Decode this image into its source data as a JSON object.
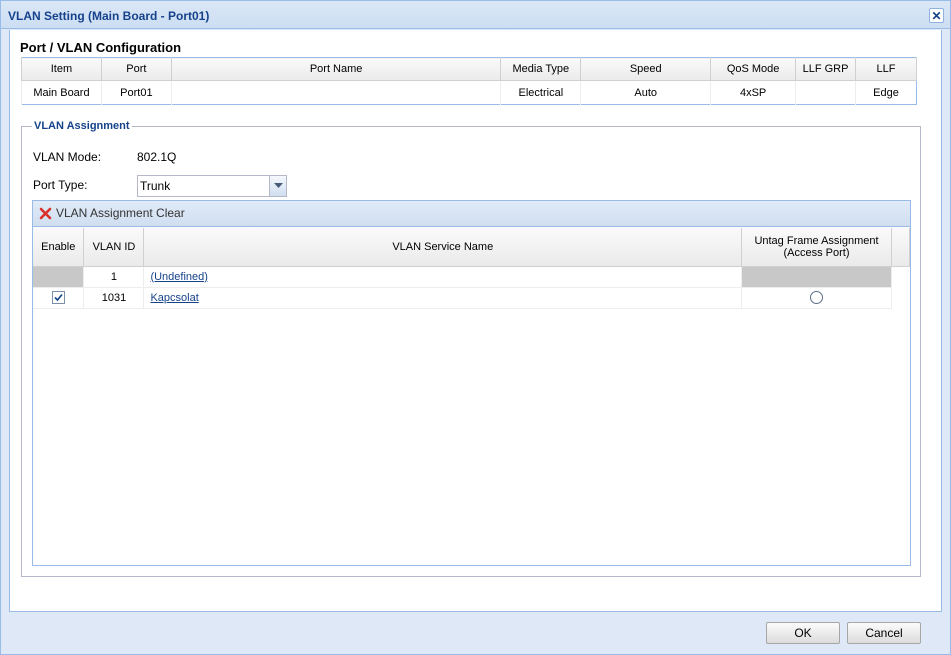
{
  "window": {
    "title": "VLAN Setting (Main Board - Port01)",
    "close_glyph": "✕"
  },
  "port_config": {
    "title": "Port / VLAN Configuration",
    "headers": [
      "Item",
      "Port",
      "Port Name",
      "Media Type",
      "Speed",
      "QoS Mode",
      "LLF GRP",
      "LLF"
    ],
    "row": [
      "Main Board",
      "Port01",
      "",
      "Electrical",
      "Auto",
      "4xSP",
      "",
      "Edge"
    ]
  },
  "vlan_assignment": {
    "legend": "VLAN Assignment",
    "mode_label": "VLAN Mode:",
    "mode_value": "802.1Q",
    "port_type_label": "Port Type:",
    "port_type_value": "Trunk",
    "toolbar": {
      "clear_label": "VLAN Assignment Clear",
      "clear_icon": "red-x-icon"
    },
    "grid": {
      "headers": {
        "enable": "Enable",
        "vlan_id": "VLAN ID",
        "service_name": "VLAN Service Name",
        "untag_line1": "Untag Frame Assignment",
        "untag_line2": "(Access Port)"
      },
      "rows": [
        {
          "enabled": null,
          "vlan_id": "1",
          "service_name": "(Undefined)",
          "untag": null
        },
        {
          "enabled": true,
          "vlan_id": "1031",
          "service_name": "Kapcsolat",
          "untag": false
        }
      ]
    }
  },
  "footer": {
    "ok_label": "OK",
    "cancel_label": "Cancel"
  },
  "colors": {
    "title_text": "#15428b",
    "border": "#99bbe8",
    "clear_icon": "#d9302c"
  }
}
